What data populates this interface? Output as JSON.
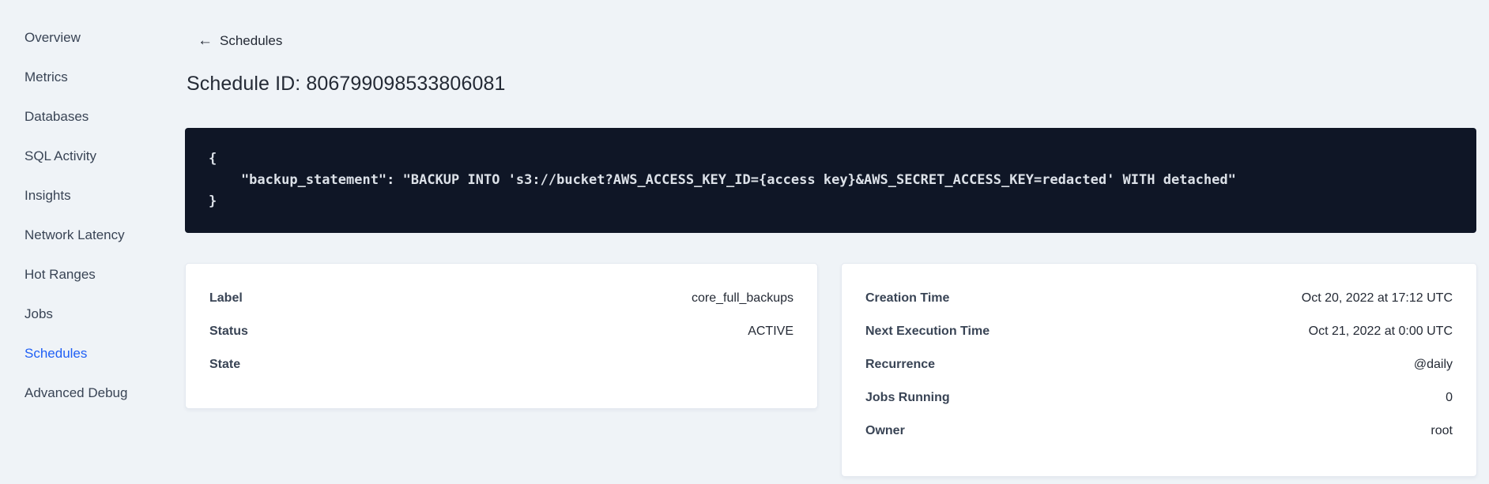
{
  "colors": {
    "background": "#eff3f7",
    "accent_blue": "#1f5ff5",
    "code_block_background": "#0f1626",
    "code_text": "#dce1e8",
    "text_primary": "#242a35",
    "text_secondary": "#394455",
    "card_background": "#ffffff"
  },
  "sidebar": {
    "items": [
      {
        "label": "Overview"
      },
      {
        "label": "Metrics"
      },
      {
        "label": "Databases"
      },
      {
        "label": "SQL Activity"
      },
      {
        "label": "Insights"
      },
      {
        "label": "Network Latency"
      },
      {
        "label": "Hot Ranges"
      },
      {
        "label": "Jobs"
      },
      {
        "label": "Schedules",
        "active": true
      },
      {
        "label": "Advanced Debug"
      }
    ]
  },
  "header": {
    "back_icon": "←",
    "back_label": "Schedules",
    "title": "Schedule ID: 806799098533806081"
  },
  "code_block": {
    "lines": [
      "{",
      "    \"backup_statement\": \"BACKUP INTO 's3://bucket?AWS_ACCESS_KEY_ID={access key}&AWS_SECRET_ACCESS_KEY=redacted' WITH detached\"",
      "}"
    ]
  },
  "details_card": {
    "rows": [
      {
        "label": "Label",
        "value": "core_full_backups"
      },
      {
        "label": "Status",
        "value": "ACTIVE"
      },
      {
        "label": "State",
        "value": ""
      }
    ]
  },
  "schedule_card": {
    "rows": [
      {
        "label": "Creation Time",
        "value": "Oct 20, 2022 at 17:12 UTC"
      },
      {
        "label": "Next Execution Time",
        "value": "Oct 21, 2022 at 0:00 UTC"
      },
      {
        "label": "Recurrence",
        "value": "@daily"
      },
      {
        "label": "Jobs Running",
        "value": "0"
      },
      {
        "label": "Owner",
        "value": "root"
      }
    ]
  }
}
